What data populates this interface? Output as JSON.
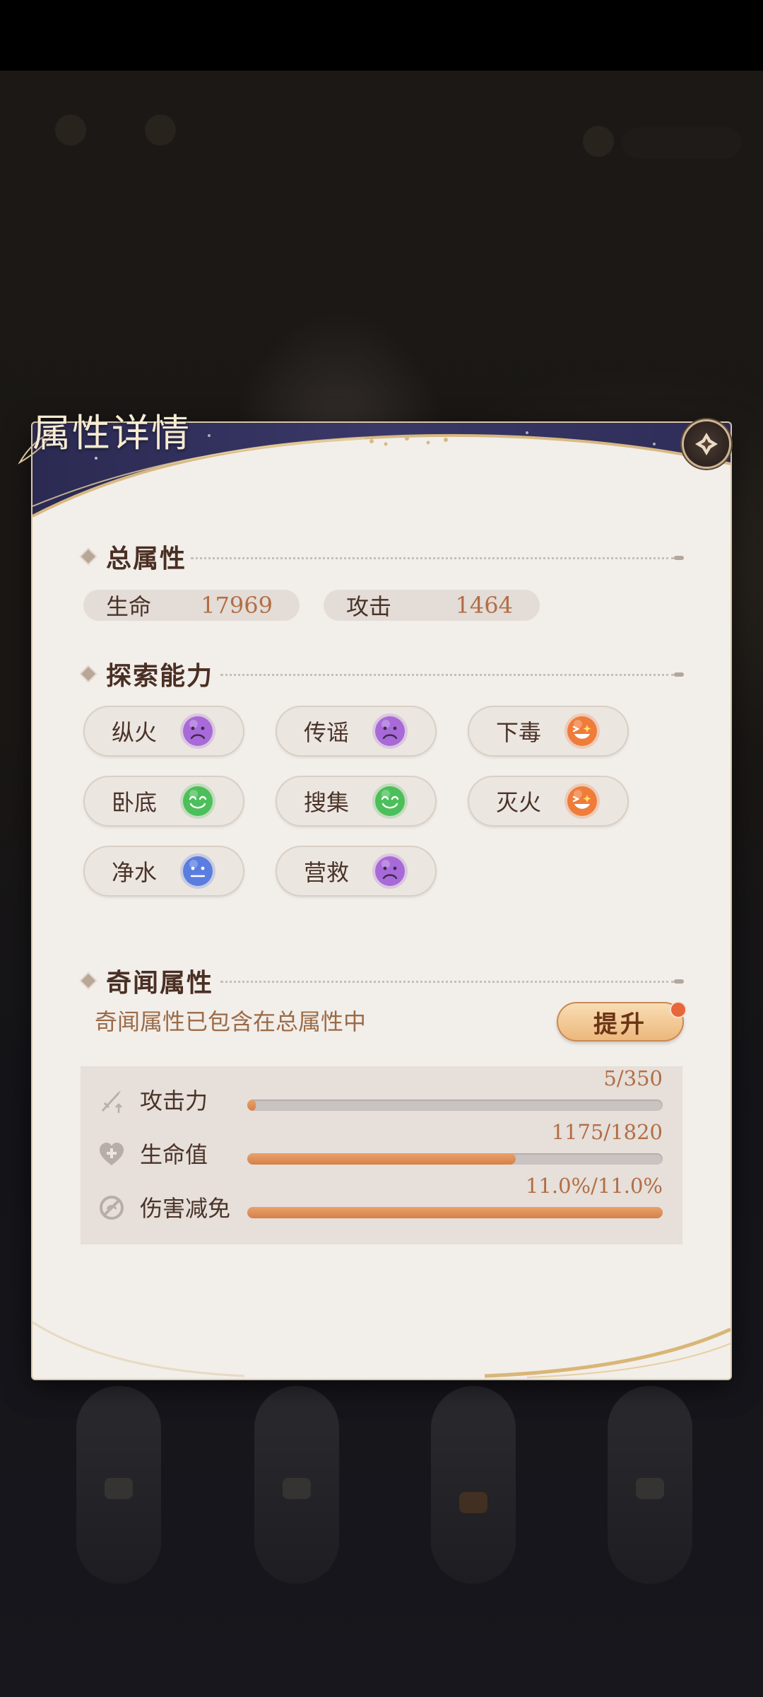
{
  "dialog": {
    "title": "属性详情",
    "close_icon": "close-emblem-icon"
  },
  "total_attributes": {
    "title": "总属性",
    "stats": [
      {
        "label": "生命",
        "value": "17969"
      },
      {
        "label": "攻击",
        "value": "1464"
      }
    ]
  },
  "exploration": {
    "title": "探索能力",
    "abilities": [
      {
        "label": "纵火",
        "mood": "sad",
        "color": "#a86ad8"
      },
      {
        "label": "传谣",
        "mood": "sad",
        "color": "#a86ad8"
      },
      {
        "label": "下毒",
        "mood": "excited",
        "color": "#f07c3a"
      },
      {
        "label": "卧底",
        "mood": "happy",
        "color": "#4cbf5a"
      },
      {
        "label": "搜集",
        "mood": "happy",
        "color": "#4cbf5a"
      },
      {
        "label": "灭火",
        "mood": "excited",
        "color": "#f07c3a"
      },
      {
        "label": "净水",
        "mood": "neutral",
        "color": "#5a7de0"
      },
      {
        "label": "营救",
        "mood": "sad",
        "color": "#a86ad8"
      }
    ]
  },
  "anecdote": {
    "title": "奇闻属性",
    "note": "奇闻属性已包含在总属性中",
    "upgrade_label": "提升",
    "bonuses": [
      {
        "label": "攻击力",
        "value": "5/350",
        "progress": 0.014,
        "icon": "sword-icon"
      },
      {
        "label": "生命值",
        "value": "1175/1820",
        "progress": 0.646,
        "icon": "heart-plus-icon"
      },
      {
        "label": "伤害减免",
        "value": "11.0%/11.0%",
        "progress": 1.0,
        "icon": "shield-reduce-icon"
      }
    ]
  }
}
